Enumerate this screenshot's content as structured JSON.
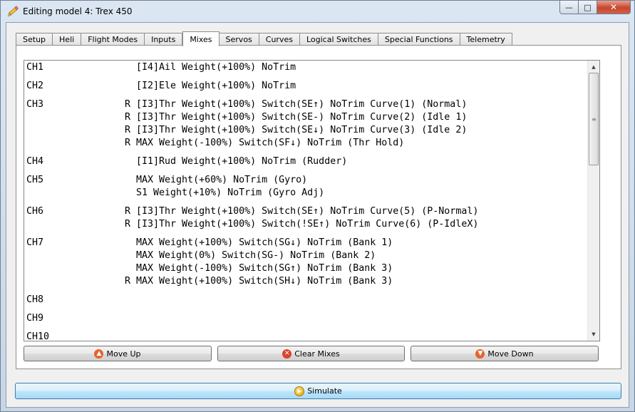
{
  "window": {
    "title": "Editing model 4: Trex 450",
    "icon": "pencil-icon",
    "minimize_label": "—",
    "maximize_label": "□",
    "close_label": "✕"
  },
  "tabs": [
    {
      "label": "Setup",
      "active": false
    },
    {
      "label": "Heli",
      "active": false
    },
    {
      "label": "Flight Modes",
      "active": false
    },
    {
      "label": "Inputs",
      "active": false
    },
    {
      "label": "Mixes",
      "active": true
    },
    {
      "label": "Servos",
      "active": false
    },
    {
      "label": "Curves",
      "active": false
    },
    {
      "label": "Logical Switches",
      "active": false
    },
    {
      "label": "Special Functions",
      "active": false
    },
    {
      "label": "Telemetry",
      "active": false
    }
  ],
  "mixes": [
    {
      "channel": "CH1",
      "lines": [
        "  [I4]Ail Weight(+100%) NoTrim"
      ]
    },
    {
      "channel": "CH2",
      "lines": [
        "  [I2]Ele Weight(+100%) NoTrim"
      ]
    },
    {
      "channel": "CH3",
      "lines": [
        "R [I3]Thr Weight(+100%) Switch(SE↑) NoTrim Curve(1) (Normal)",
        "R [I3]Thr Weight(+100%) Switch(SE-) NoTrim Curve(2) (Idle 1)",
        "R [I3]Thr Weight(+100%) Switch(SE↓) NoTrim Curve(3) (Idle 2)",
        "R MAX Weight(-100%) Switch(SF↓) NoTrim (Thr Hold)"
      ]
    },
    {
      "channel": "CH4",
      "lines": [
        "  [I1]Rud Weight(+100%) NoTrim (Rudder)"
      ]
    },
    {
      "channel": "CH5",
      "lines": [
        "  MAX Weight(+60%) NoTrim (Gyro)",
        "  S1 Weight(+10%) NoTrim (Gyro Adj)"
      ]
    },
    {
      "channel": "CH6",
      "lines": [
        "R [I3]Thr Weight(+100%) Switch(SE↑) NoTrim Curve(5) (P-Normal)",
        "R [I3]Thr Weight(+100%) Switch(!SE↑) NoTrim Curve(6) (P-IdleX)"
      ]
    },
    {
      "channel": "CH7",
      "lines": [
        "  MAX Weight(+100%) Switch(SG↓) NoTrim (Bank 1)",
        "  MAX Weight(0%) Switch(SG-) NoTrim (Bank 2)",
        "  MAX Weight(-100%) Switch(SG↑) NoTrim (Bank 3)",
        "R MAX Weight(+100%) Switch(SH↓) NoTrim (Bank 3)"
      ]
    },
    {
      "channel": "CH8",
      "lines": []
    },
    {
      "channel": "CH9",
      "lines": []
    },
    {
      "channel": "CH10",
      "lines": []
    }
  ],
  "buttons": {
    "move_up": {
      "label": "Move Up",
      "icon": "arrow-up-icon",
      "color": "#e8622a"
    },
    "clear_mixes": {
      "label": "Clear Mixes",
      "icon": "clear-icon",
      "color": "#d9432a"
    },
    "move_down": {
      "label": "Move Down",
      "icon": "arrow-down-icon",
      "color": "#e8622a"
    },
    "simulate": {
      "label": "Simulate",
      "icon": "play-icon",
      "color": "#e0a000"
    }
  }
}
